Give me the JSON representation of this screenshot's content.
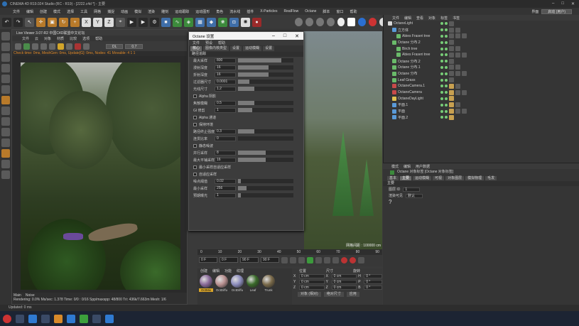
{
  "window": {
    "title": "CINEMA 4D R19.024 Studio (RC - R19) - [2222.c4d *] - 主要"
  },
  "menubar": {
    "items": [
      "文件",
      "编辑",
      "创建",
      "模式",
      "选择",
      "工具",
      "网格",
      "捕捉",
      "动画",
      "模拟",
      "渲染",
      "雕刻",
      "运动跟踪",
      "运动图形",
      "角色",
      "流水线",
      "插件",
      "X-Particles",
      "RealFlow",
      "Octane",
      "脚本",
      "窗口",
      "帮助"
    ],
    "layout_label": "界面",
    "layout_value": "启动 (用户)"
  },
  "toolbar": {
    "axis_x": "X",
    "axis_y": "Y",
    "axis_z": "Z"
  },
  "viewer": {
    "title": "Live Viewer 3.07-R2 中国C4D联盟中文论坛",
    "menu": [
      "文件",
      "云",
      "对象",
      "材质",
      "比较",
      "选项",
      "帮助"
    ],
    "mode_value": "DL",
    "zoom_value": "0.7",
    "status_line": "Check time: 0ms, MeshGen: 0ms, Update[G]: 0ms, Nodes: 41 Movable: 4 1 1",
    "tabs": [
      "Main",
      "Noise"
    ],
    "stats": "Rendering: 0.0%  Ms/sec: 1.378  Time: 0/0 : 0/16  Spp/maxspp: 48/800  Tri: 436k/7.663m  Mesh: 1/6"
  },
  "dialog": {
    "title": "Octane 设置",
    "menu": [
      "文件",
      "预设",
      "帮助"
    ],
    "tabs": [
      "核心",
      "图像内核类型",
      "设置",
      "运动模糊",
      "设置"
    ],
    "section_kernel": "路径追踪",
    "rows": [
      {
        "label": "最大采样",
        "value": "800",
        "fill": 0.78
      },
      {
        "label": "漫射深度",
        "value": "16",
        "fill": 0.55
      },
      {
        "label": "折射深度",
        "value": "16",
        "fill": 0.55
      },
      {
        "label": "过滤器尺寸",
        "value": "0.0001",
        "fill": 0.2
      },
      {
        "label": "光线尺寸",
        "value": "1.2",
        "fill": 0.3
      }
    ],
    "alpha_shadows": "Alpha 阴影",
    "rows2": [
      {
        "label": "焦散模糊",
        "value": "0.5",
        "fill": 0.3
      },
      {
        "label": "GI 修剪",
        "value": "1",
        "fill": 0.25
      }
    ],
    "alpha_channel": "Alpha 通道",
    "keep_env": "保持环境",
    "rows3": [
      {
        "label": "路径终止强度",
        "value": "0.3",
        "fill": 0.3
      },
      {
        "label": "连贯比率",
        "value": "0",
        "fill": 0.0
      }
    ],
    "static_noise": "静态噪波",
    "rows4": [
      {
        "label": "并行采样",
        "value": "8",
        "fill": 0.5
      },
      {
        "label": "最大平铺采样",
        "value": "16",
        "fill": 0.5
      }
    ],
    "min_adapt": "最小采样自适应采样",
    "adaptive": "自适应采样",
    "rows5": [
      {
        "label": "噪点阈值",
        "value": "0.02",
        "fill": 0.05
      },
      {
        "label": "最小采样",
        "value": "256",
        "fill": 0.15
      },
      {
        "label": "预期曝光",
        "value": "1",
        "fill": 0.05
      }
    ]
  },
  "viewport2": {
    "grid_label": "网格间距 : 100000 cm"
  },
  "timeline": {
    "ticks": [
      "0",
      "10",
      "20",
      "30",
      "40",
      "50",
      "60",
      "70",
      "80",
      "90"
    ],
    "frame_value": "0 F",
    "start_value": "0 F",
    "end_value": "90 F",
    "cur_value": "90 F"
  },
  "materials": {
    "tabs": [
      "创建",
      "编辑",
      "功能",
      "纹理"
    ],
    "items": [
      "OctMix",
      "OctDiffu",
      "OctDiffu",
      "Leaf",
      "Trunk"
    ]
  },
  "coords": {
    "headers": [
      "位置",
      "尺寸",
      "旋转"
    ],
    "rows": [
      {
        "ax": "X",
        "pos": "0 cm",
        "size": "0 cm",
        "rotl": "H",
        "rot": "0 °"
      },
      {
        "ax": "Y",
        "pos": "0 cm",
        "size": "0 cm",
        "rotl": "P",
        "rot": "0 °"
      },
      {
        "ax": "Z",
        "pos": "0 cm",
        "size": "0 cm",
        "rotl": "B",
        "rot": "0 °"
      }
    ],
    "mode": "对象 (相对)",
    "size_mode": "绝对尺寸",
    "apply": "应用"
  },
  "objects": {
    "tabs": [
      "文件",
      "编辑",
      "查看",
      "对象",
      "标签",
      "书签"
    ],
    "items": [
      {
        "name": "OctaneLight"
      },
      {
        "name": "立方体"
      },
      {
        "name": "Abies Fraseri tree"
      },
      {
        "name": "Octane 分布.2"
      },
      {
        "name": "Birch tree"
      },
      {
        "name": "Abies Fraseri tree"
      },
      {
        "name": "Octane 分布.2"
      },
      {
        "name": "Octane 分布.1"
      },
      {
        "name": "Octane 分布"
      },
      {
        "name": "Leaf Grass"
      },
      {
        "name": "OctaneCamera.1"
      },
      {
        "name": "OctaneCamera"
      },
      {
        "name": "OctaneDayLight"
      },
      {
        "name": "平面.1"
      },
      {
        "name": "平面"
      },
      {
        "name": "平面.2"
      }
    ]
  },
  "attributes": {
    "tabs": [
      "模式",
      "编辑",
      "用户数据"
    ],
    "title": "Octane 对象标签 [Octane 对象标签]",
    "subtabs": [
      "基本",
      "主要",
      "运动模糊",
      "可视",
      "对象图层",
      "模拟物理",
      "毛发"
    ],
    "section": "主要",
    "layer_id_label": "图层 ID",
    "layer_id_value": "1",
    "render_label": "渲染可见",
    "render_value": "默认"
  },
  "statusbar": {
    "text": "Updated: 0 ms"
  },
  "taskbar": {
    "clock": ""
  }
}
